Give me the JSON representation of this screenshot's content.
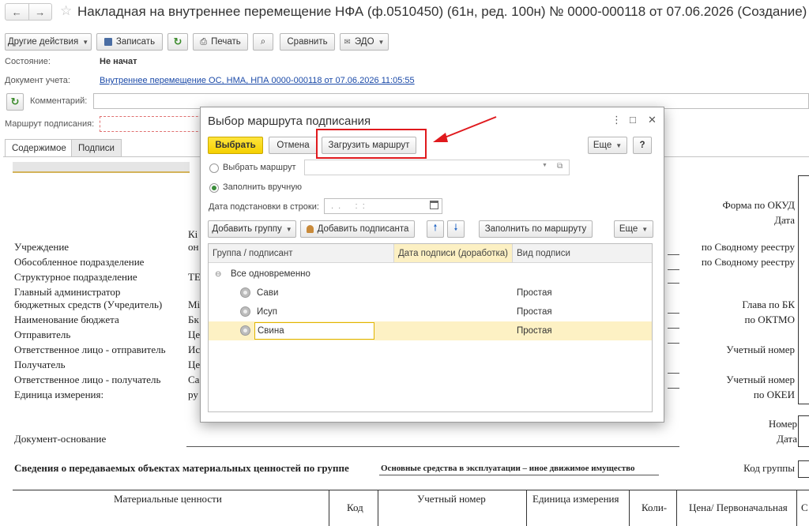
{
  "window": {
    "title": "Накладная на внутреннее перемещение НФА (ф.0510450) (61н, ред. 100н) № 0000-000118 от 07.06.2026 (Создание)",
    "back_icon": "arrow-left-icon",
    "forward_icon": "arrow-right-icon",
    "favorite_icon": "star-icon"
  },
  "toolbar": {
    "other_actions": "Другие действия",
    "save": "Записать",
    "print": "Печать",
    "compare": "Сравнить",
    "edo": "ЭДО"
  },
  "header": {
    "status_label": "Состояние:",
    "status_value": "Не начат",
    "accounting_doc_label": "Документ учета:",
    "accounting_doc_link": "Внутреннее перемещение ОС, НМА, НПА 0000-000118 от 07.06.2026 11:05:55",
    "comment_label": "Комментарий:",
    "comment_value": "",
    "route_label": "Маршрут подписания:"
  },
  "tabs": [
    {
      "label": "Содержимое",
      "active": true
    },
    {
      "label": "Подписи",
      "active": false
    }
  ],
  "form": {
    "left_labels": [
      "Учреждение",
      "Обособленное подразделение",
      "Структурное подразделение",
      "Главный администратор",
      "бюджетных средств (Учредитель)",
      "Наименование бюджета",
      "Отправитель",
      "Ответственное лицо - отправитель",
      "Получатель",
      "Ответственное лицо - получатель",
      "Единица измерения:"
    ],
    "left_values": [
      "Кі",
      "он",
      "",
      "ТЕ",
      "",
      "Mi",
      "Бк",
      "Це",
      "Ис",
      "Це",
      "Са",
      "ру"
    ],
    "right_labels": [
      "Форма по ОКУД",
      "Дата",
      "по Сводному реестру",
      "по Сводному реестру",
      "Глава по БК",
      "по ОКТМО",
      "Учетный номер",
      "Учетный номер",
      "по ОКЕИ",
      "Номер",
      "Дата"
    ],
    "doc_basis": "Документ-основание",
    "group_caption": "Сведения о передаваемых объектах материальных ценностей по группе",
    "group_value": "Основные средства в эксплуатации – иное движимое имущество",
    "group_code_label": "Код группы",
    "table_headers": [
      "Материальные ценности",
      "Код",
      "Учетный номер",
      "Единица измерения",
      "Коли-",
      "Цена/ Первоначальная",
      "С"
    ]
  },
  "modal": {
    "title": "Выбор маршрута подписания",
    "menu_icon": "more-vertical-icon",
    "maximize_icon": "maximize-icon",
    "close_icon": "close-icon",
    "btn_select": "Выбрать",
    "btn_cancel": "Отмена",
    "btn_load_route": "Загрузить маршрут",
    "btn_more": "Еще",
    "btn_help": "?",
    "radio_choose_route": "Выбрать маршрут",
    "route_value": "",
    "radio_fill_manual": "Заполнить вручную",
    "date_label": "Дата подстановки в строки:",
    "date_placeholder": ".  .      :  :",
    "btn_add_group": "Добавить группу",
    "btn_add_signer": "Добавить подписанта",
    "btn_fill_by_route": "Заполнить по маршруту",
    "btn_more2": "Еще",
    "grid_headers": {
      "group_signer": "Группа / подписант",
      "sign_date": "Дата подписи (доработка)",
      "sign_type": "Вид подписи"
    },
    "group_row": "Все одновременно",
    "rows": [
      {
        "name": "Сави",
        "date": "",
        "type": "Простая"
      },
      {
        "name": "Исуп",
        "date": "",
        "type": "Простая"
      },
      {
        "name": "Свина",
        "date": "",
        "type": "Простая"
      }
    ]
  },
  "colors": {
    "accent_yellow": "#f5d000",
    "highlight_row": "#fdf1c4",
    "annotation_red": "#e0191d",
    "link_blue": "#1b4aa8"
  }
}
